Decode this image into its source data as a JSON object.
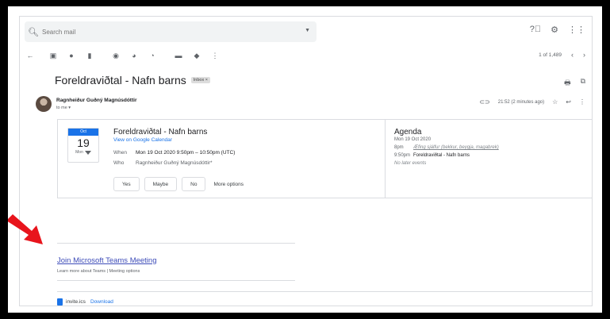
{
  "search": {
    "placeholder": "Search mail"
  },
  "pager": {
    "text": "1 of 1,489",
    "prev": "‹",
    "next": "›"
  },
  "email": {
    "subject": "Foreldraviðtal - Nafn barns",
    "label": "Inbox ×",
    "sender": "Ragnheiður Guðný Magnúsdóttir",
    "to": "to me ▾",
    "time": "21:52 (2 minutes ago)"
  },
  "event": {
    "month": "Oct",
    "day": "19",
    "dow": "Mon",
    "title": "Foreldraviðtal - Nafn barns",
    "calendar_link": "View on Google Calendar",
    "when_label": "When",
    "when": "Mon 19 Oct 2020 9:50pm – 10:50pm (UTC)",
    "who_label": "Who",
    "who": "Ragnheiður Guðný Magnúsdóttir*",
    "rsvp": {
      "yes": "Yes",
      "maybe": "Maybe",
      "no": "No",
      "more": "More options"
    }
  },
  "agenda": {
    "title": "Agenda",
    "date": "Mon 19 Oct 2020",
    "items": [
      {
        "time": "8pm",
        "title": "Æfing sjálfur (bekkur, beygja, magabrek)"
      },
      {
        "time": "9:50pm",
        "title": "Foreldraviðtal - Nafn barns"
      }
    ],
    "no_later": "No later events"
  },
  "teams": {
    "link": "Join Microsoft Teams Meeting",
    "sub": "Learn more about Teams | Meeting options"
  },
  "attachment": {
    "name": "invite.ics",
    "download": "Download"
  },
  "colors": {
    "accent": "#1a73e8",
    "arrow": "#e8141c",
    "teams_link": "#3c4bb8"
  }
}
